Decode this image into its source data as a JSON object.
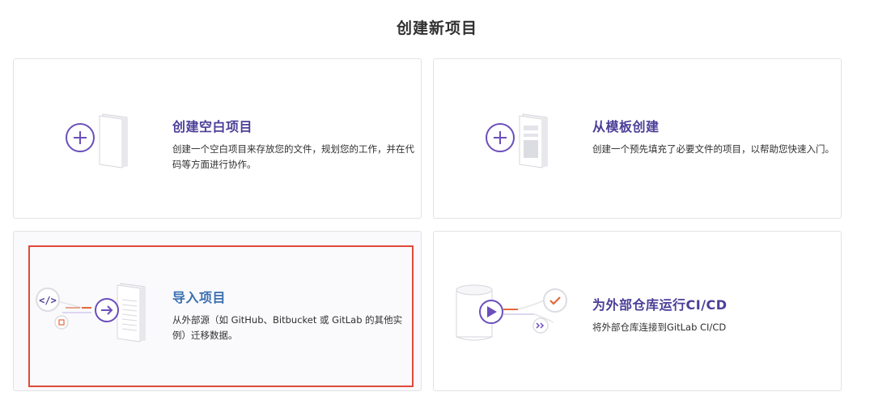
{
  "page": {
    "title": "创建新项目"
  },
  "cards": [
    {
      "title": "创建空白项目",
      "desc": "创建一个空白项目来存放您的文件，规划您的工作，并在代码等方面进行协作。"
    },
    {
      "title": "从模板创建",
      "desc": "创建一个预先填充了必要文件的项目，以帮助您快速入门。"
    },
    {
      "title": "导入项目",
      "desc": "从外部源（如 GitHub、Bitbucket 或 GitLab 的其他实例）迁移数据。"
    },
    {
      "title": "为外部仓库运行CI/CD",
      "desc": "将外部仓库连接到GitLab CI/CD"
    }
  ],
  "colors": {
    "accent_purple": "#4b3f98",
    "accent_blue": "#3a6fb0",
    "selected_outline": "#dd4b39",
    "icon_purple": "#6b4fbb",
    "icon_orange": "#e4683a"
  },
  "icons": [
    "plus-icon",
    "code-icon",
    "arrow-right-icon",
    "play-icon",
    "check-icon",
    "chevrons-right-icon"
  ]
}
